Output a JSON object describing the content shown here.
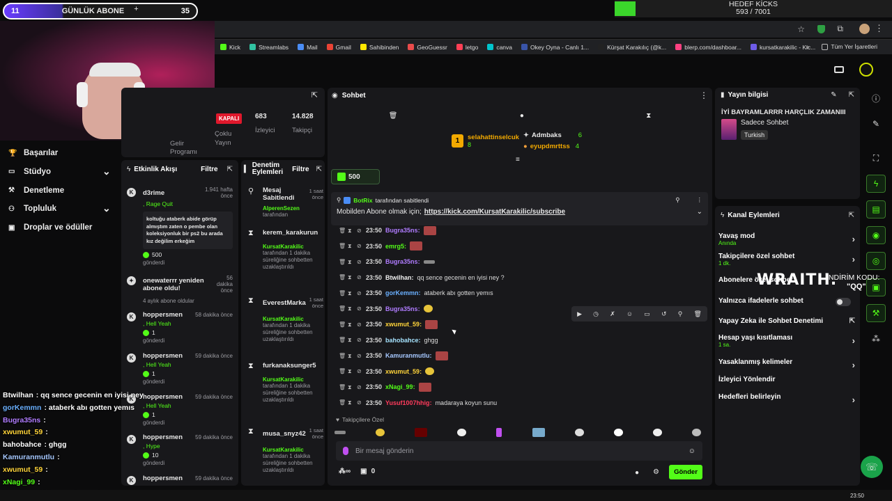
{
  "overlay": {
    "sub_goal": {
      "left_count": "11",
      "label": "GÜNLÜK ABONE",
      "plus": "+",
      "right_count": "35"
    },
    "kicks": {
      "title": "HEDEF KİCKS",
      "progress": "593 / 7001"
    },
    "wraith": {
      "brand": "WRAITH.",
      "code_label": "İNDİRİM KODU:",
      "code": "\"QQ\""
    }
  },
  "browser": {
    "bookmarks": [
      {
        "label": "Kick",
        "color": "#53fc18"
      },
      {
        "label": "Streamlabs",
        "color": "#31c3a2"
      },
      {
        "label": "Mail",
        "color": "#4a8df6"
      },
      {
        "label": "Gmail",
        "color": "#ea4335"
      },
      {
        "label": "Sahibinden",
        "color": "#ffe800"
      },
      {
        "label": "GeoGuessr",
        "color": "#e94b4b"
      },
      {
        "label": "letgo",
        "color": "#ff3f55"
      },
      {
        "label": "canva",
        "color": "#00c4cc"
      },
      {
        "label": "Okey Oyna - Canlı 1...",
        "color": "#3954a8"
      },
      {
        "label": "Kürşat Karakılıç (@k...",
        "color": "#222222"
      },
      {
        "label": "blerp.com/dashboar...",
        "color": "#ff4081"
      },
      {
        "label": "kursatkarakilic - Kic...",
        "color": "#6e5ce8"
      }
    ],
    "more": "»",
    "all_bookmarks": "Tüm Yer İşaretleri"
  },
  "left_nav": {
    "items": [
      {
        "label": "Başarılar",
        "icon": "trophy-icon"
      },
      {
        "label": "Stüdyo",
        "icon": "video-icon"
      },
      {
        "label": "Denetleme",
        "icon": "wrench-icon"
      },
      {
        "label": "Topluluk",
        "icon": "users-icon"
      },
      {
        "label": "Droplar ve ödüller",
        "icon": "gift-icon"
      }
    ]
  },
  "stream_info": {
    "status_badge": "KAPALI",
    "viewers": "683",
    "viewers_label": "İzleyici",
    "followers": "14.828",
    "followers_label": "Takipçi",
    "multi": "Çoklu Yayın",
    "program": "Gelir Programı"
  },
  "activity_feed": {
    "title": "Etkinlik Akışı",
    "filter": "Filtre",
    "items": [
      {
        "user": "d3rime",
        "time": "1.941 hafta önce",
        "tag": ", Rage Quit",
        "message": "koltuğu ataberk abide görüp almıştım zaten o pembe olan koleksiyonluk bir ps2 bu arada kız değilim erkeğim",
        "amount": "500",
        "sent": "gönderdi"
      },
      {
        "user": "onewaterrr yeniden abone oldu!",
        "time": "56 dakika önce",
        "tag": "",
        "note": "4 aylık abone oldular"
      },
      {
        "user": "hoppersmen",
        "time": "58 dakika önce",
        "tag": ", Hell Yeah",
        "amount": "1",
        "sent": "gönderdi"
      },
      {
        "user": "hoppersmen",
        "time": "59 dakika önce",
        "tag": ", Hell Yeah",
        "amount": "1",
        "sent": "gönderdi"
      },
      {
        "user": "hoppersmen",
        "time": "59 dakika önce",
        "tag": ", Hell Yeah",
        "amount": "1",
        "sent": "gönderdi"
      },
      {
        "user": "hoppersmen",
        "time": "59 dakika önce",
        "tag": ", Hype",
        "amount": "10",
        "sent": "gönderdi"
      },
      {
        "user": "hoppersmen",
        "time": "59 dakika önce"
      }
    ]
  },
  "mod_actions": {
    "title": "Denetim Eylemleri",
    "filter": "Filtre",
    "items": [
      {
        "user": "Mesaj Sabitlendi",
        "time": "1 saat önce",
        "actor": "AlperenSezen",
        "desc": "tarafından"
      },
      {
        "user": "kerem_karakurun",
        "time": "",
        "actor": "KursatKarakilic",
        "desc": "tarafından 1 dakika süreliğine sohbetten uzaklaştırıldı"
      },
      {
        "user": "EverestMarka",
        "time": "1 saat önce",
        "actor": "KursatKarakilic",
        "desc": "tarafından 1 dakika süreliğine sohbetten uzaklaştırıldı"
      },
      {
        "user": "furkanaksunger5",
        "time": "",
        "actor": "KursatKarakilic",
        "desc": "tarafından 1 dakika süreliğine sohbetten uzaklaştırıldı"
      },
      {
        "user": "musa_snyz42",
        "time": "1 saat önce",
        "actor": "KursatKarakilic",
        "desc": "tarafından 1 dakika süreliğine sohbetten uzaklaştırıldı"
      }
    ]
  },
  "chat": {
    "title": "Sohbet",
    "leaders": [
      {
        "name": "selahattinselcuk",
        "count": "8",
        "rank": "1"
      },
      {
        "name": "Admbaks",
        "count": "6"
      },
      {
        "name": "eyupdmrttss",
        "count": "4"
      }
    ],
    "kick_amount": "500",
    "pinned": {
      "by_user": "BotRix",
      "by_label": "tarafından sabitlendi",
      "text": "Mobilden Abone olmak için;",
      "link": "https://kick.com/KursatKarakilic/subscribe"
    },
    "messages": [
      {
        "time": "23:50",
        "user": "Bugra35ns",
        "color": "#b07cff",
        "text": "",
        "emote": "red"
      },
      {
        "time": "23:50",
        "user": "emrg5",
        "color": "#53fc18",
        "text": "",
        "emote": "red"
      },
      {
        "time": "23:50",
        "user": "Bugra35ns",
        "color": "#b07cff",
        "text": "",
        "emote": "gray"
      },
      {
        "time": "23:50",
        "user": "Btwilhan",
        "color": "#f0f0f0",
        "text": "qq sence gecenin en iyisi ney ?"
      },
      {
        "time": "23:50",
        "user": "gorKemmn",
        "color": "#6ab0ff",
        "text": "ataberk abı gotten yemıs"
      },
      {
        "time": "23:50",
        "user": "Bugra35ns",
        "color": "#b07cff",
        "text": "",
        "emote": "yellow"
      },
      {
        "time": "23:50",
        "user": "xwumut_59",
        "color": "#ffd43a",
        "text": "",
        "emote": "red"
      },
      {
        "time": "23:50",
        "user": "bahobahce",
        "color": "#a6e3ff",
        "text": "ghgg"
      },
      {
        "time": "23:50",
        "user": "Kamuranmutlu",
        "color": "#a6c8ff",
        "text": "",
        "emote": "red"
      },
      {
        "time": "23:50",
        "user": "xwumut_59",
        "color": "#ffd43a",
        "text": "",
        "emote": "yellow"
      },
      {
        "time": "23:50",
        "user": "xNagi_99",
        "color": "#53fc18",
        "text": "",
        "emote": "red"
      },
      {
        "time": "23:50",
        "user": "Yusuf1007hhig",
        "color": "#ff3b5c",
        "text": "madaraya koyun sunu"
      }
    ],
    "followers_only_label": "Takipçilere Özel",
    "input_placeholder": "Bir mesaj gönderin",
    "send_label": "Gönder",
    "store_count": "0"
  },
  "stream_panel": {
    "title": "Yayın bilgisi",
    "stream_title": "İYİ BAYRAMLARRR HARÇLIK ZAMANIII",
    "category": "Sadece Sohbet",
    "language": "Turkish"
  },
  "channel_actions": {
    "title": "Kanal Eylemleri",
    "items": [
      {
        "label": "Yavaş mod",
        "sub": "Anında",
        "chevron": true
      },
      {
        "label": "Takipçilere özel sohbet",
        "sub": "1 dk.",
        "chevron": true
      },
      {
        "label": "Abonelere özel sohbet",
        "sub": "",
        "chevron": false
      },
      {
        "label": "Yalnızca ifadelerle sohbet",
        "sub": "",
        "toggle": true
      },
      {
        "label": "Yapay Zeka ile Sohbet Denetimi",
        "sub": "",
        "external": true
      },
      {
        "label": "Hesap yaşı kısıtlaması",
        "sub": "1 sa.",
        "chevron": true
      },
      {
        "label": "Yasaklanmış kelimeler",
        "sub": "",
        "chevron": true
      },
      {
        "label": "İzleyici Yönlendir",
        "sub": ""
      },
      {
        "label": "Hedefleri belirleyin",
        "sub": "",
        "chevron": true
      }
    ]
  },
  "overlay_chat": [
    {
      "user": "Btwilhan",
      "color": "#ffffff",
      "text": ": qq sence gecenin en iyisi ney"
    },
    {
      "user": "gorKemmn",
      "color": "#6ab0ff",
      "text": ": ataberk abı gotten yemıs"
    },
    {
      "user": "Bugra35ns",
      "color": "#b07cff",
      "text": ":"
    },
    {
      "user": "xwumut_59",
      "color": "#ffd43a",
      "text": ":"
    },
    {
      "user": "bahobahce",
      "color": "#ffffff",
      "text": ": ghgg"
    },
    {
      "user": "Kamuranmutlu",
      "color": "#a6c8ff",
      "text": ":"
    },
    {
      "user": "xwumut_59",
      "color": "#ffd43a",
      "text": ":"
    },
    {
      "user": "xNagi_99",
      "color": "#53fc18",
      "text": ":"
    },
    {
      "user": "Yusuf1007hhig",
      "color": "#ff3b5c",
      "text": ": madaraya koyun sunu"
    }
  ],
  "taskbar": {
    "time": "23:50"
  }
}
